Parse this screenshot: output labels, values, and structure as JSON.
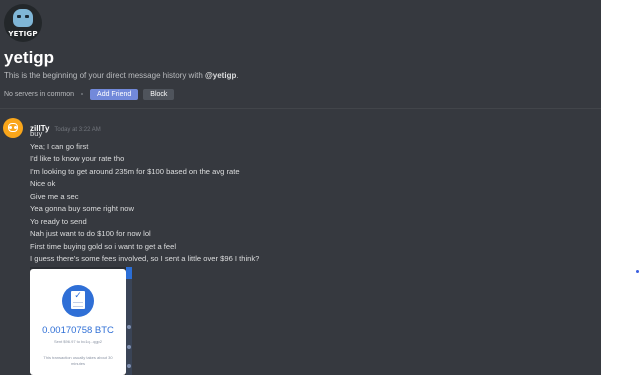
{
  "header": {
    "avatar_logo_text": "YETIGP",
    "title": "yetigp",
    "intro_prefix": "This is the beginning of your direct message history with ",
    "intro_mention": "@yetigp",
    "intro_suffix": ".",
    "servers_text": "No servers in common",
    "add_friend_label": "Add Friend",
    "block_label": "Block"
  },
  "colors": {
    "background": "#36393f",
    "accent": "#7289da",
    "btc_blue": "#2f6fd6",
    "user_avatar": "#faa61a"
  },
  "message": {
    "avatar_icon": "discord-default-avatar-icon",
    "username": "zillTy",
    "timestamp": "Today at 3:22 AM",
    "lines": [
      "buy",
      "Yea; I can go first",
      "I'd like to know your rate tho",
      "I'm looking to get around 235m for $100 based on the avg rate",
      "Nice ok",
      "Give me a sec",
      "Yea gonna buy some right now",
      "Yo ready to send",
      "Nah just want to do $100 for now lol",
      "First time buying gold so i want to get a feel",
      "I guess there's some fees involved, so I sent a little over $96 I think?"
    ]
  },
  "attachment": {
    "icon": "document-check-icon",
    "amount": "0.00170758 BTC",
    "sent_text": "Sent $96.97 to bc1q...qgp2",
    "note": "This transaction usually takes about 30 minutes"
  }
}
